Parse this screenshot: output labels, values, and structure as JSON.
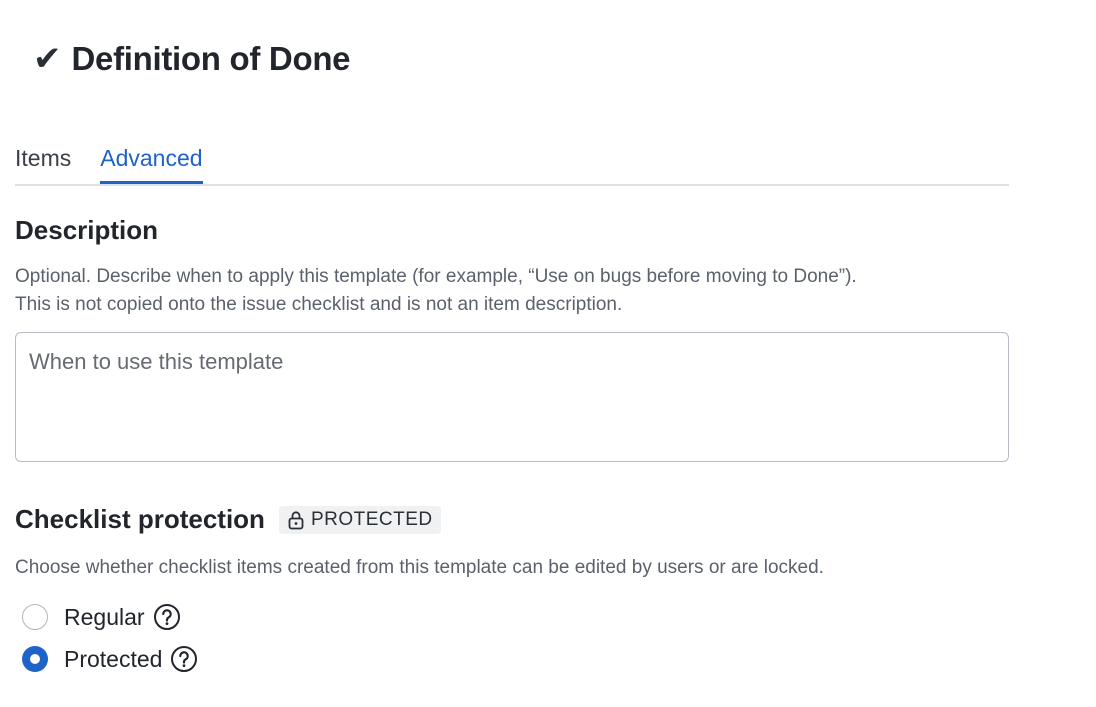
{
  "header": {
    "title": "Definition of Done",
    "title_icon": "check-mark-icon"
  },
  "tabs": [
    {
      "label": "Items",
      "active": false
    },
    {
      "label": "Advanced",
      "active": true
    }
  ],
  "description": {
    "heading": "Description",
    "help_line1": "Optional. Describe when to apply this template (for example, “Use on bugs before moving to Done”).",
    "help_line2": "This is not copied onto the issue checklist and is not an item description.",
    "value": "",
    "placeholder": "When to use this template"
  },
  "protection": {
    "heading": "Checklist protection",
    "badge_label": "PROTECTED",
    "badge_icon": "lock-icon",
    "help": "Choose whether checklist items created from this template can be edited by users or are locked.",
    "options": [
      {
        "label": "Regular",
        "selected": false,
        "help_icon": "question-circle-icon"
      },
      {
        "label": "Protected",
        "selected": true,
        "help_icon": "question-circle-icon"
      }
    ]
  },
  "colors": {
    "accent": "#1d63c8",
    "text": "#22262c",
    "muted": "#5b616b",
    "border": "#b8bcc4"
  }
}
